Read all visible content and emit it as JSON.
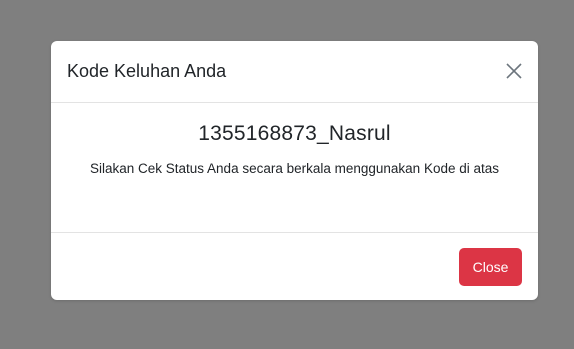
{
  "modal": {
    "title": "Kode Keluhan Anda",
    "close_icon": "close-icon",
    "code": "1355168873_Nasrul",
    "message": "Silakan Cek Status Anda secara berkala menggunakan Kode di atas",
    "close_button_label": "Close"
  },
  "colors": {
    "backdrop": "#7f7f7f",
    "danger": "#dc3545"
  }
}
